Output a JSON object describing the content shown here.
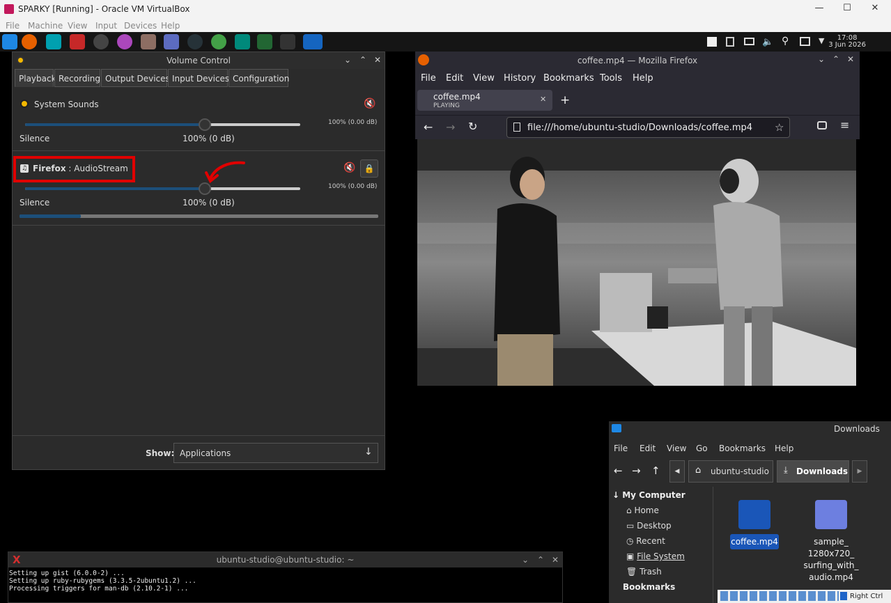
{
  "host": {
    "window_title": "SPARKY [Running] - Oracle VM VirtualBox",
    "menu": [
      "File",
      "Machine",
      "View",
      "Input",
      "Devices",
      "Help"
    ],
    "status_right": "Right Ctrl"
  },
  "panel": {
    "time": "17:08",
    "date": "3 Jun 2026"
  },
  "volume_control": {
    "title": "Volume Control",
    "tabs": [
      "Playback",
      "Recording",
      "Output Devices",
      "Input Devices",
      "Configuration"
    ],
    "streams": [
      {
        "app": "System Sounds",
        "source": "",
        "db_right": "100% (0.00 dB)",
        "left_label": "Silence",
        "center_label": "100% (0 dB)",
        "level": 0.65
      },
      {
        "app": "Firefox",
        "source": "AudioStream",
        "separator": " : ",
        "db_right": "100% (0.00 dB)",
        "left_label": "Silence",
        "center_label": "100% (0 dB)",
        "level": 0.65,
        "meter": 0.17
      }
    ],
    "show_label": "Show:",
    "show_value": "Applications"
  },
  "firefox": {
    "title": "coffee.mp4 — Mozilla Firefox",
    "menu": [
      "File",
      "Edit",
      "View",
      "History",
      "Bookmarks",
      "Tools",
      "Help"
    ],
    "tab_title": "coffee.mp4",
    "tab_status": "PLAYING",
    "url": "file:///home/ubuntu-studio/Downloads/coffee.mp4"
  },
  "files": {
    "title": "Downloads",
    "menu": [
      "File",
      "Edit",
      "View",
      "Go",
      "Bookmarks",
      "Help"
    ],
    "crumbs": [
      "ubuntu-studio",
      "Downloads"
    ],
    "sidebar_header": "My Computer",
    "sidebar_items": [
      "Home",
      "Desktop",
      "Recent",
      "File System",
      "Trash"
    ],
    "sidebar_header2": "Bookmarks",
    "file1": "coffee.mp4",
    "file2_lines": [
      "sample_",
      "1280x720_",
      "surfing_with_",
      "audio.mp4"
    ]
  },
  "terminal": {
    "title": "ubuntu-studio@ubuntu-studio: ~",
    "lines": [
      "Setting up gist (6.0.0-2) ...",
      "Setting up ruby-rubygems (3.3.5-2ubuntu1.2) ...",
      "Processing triggers for man-db (2.10.2-1) ..."
    ]
  },
  "colors": {
    "accent": "#1c4f7a",
    "highlight": "#e00000",
    "selection": "#1a56b8"
  }
}
